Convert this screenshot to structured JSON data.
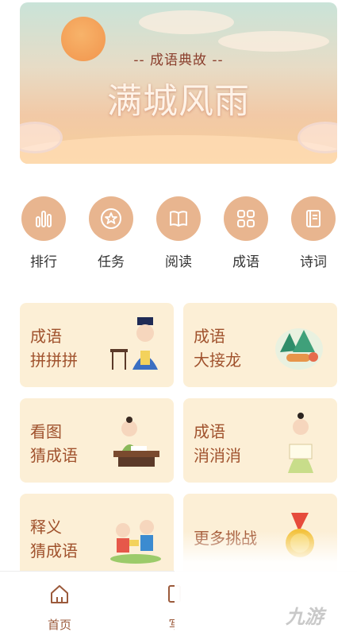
{
  "banner": {
    "subtitle": "-- 成语典故 --",
    "title": "满城风雨"
  },
  "quick_menu": [
    {
      "label": "排行",
      "icon": "bar-chart-icon"
    },
    {
      "label": "任务",
      "icon": "star-medal-icon"
    },
    {
      "label": "阅读",
      "icon": "book-icon"
    },
    {
      "label": "成语",
      "icon": "grid-icon"
    },
    {
      "label": "诗词",
      "icon": "notebook-icon"
    }
  ],
  "games": [
    {
      "line1": "成语",
      "line2": "拼拼拼"
    },
    {
      "line1": "成语",
      "line2": "大接龙"
    },
    {
      "line1": "看图",
      "line2": "猜成语"
    },
    {
      "line1": "成语",
      "line2": "消消消"
    },
    {
      "line1": "释义",
      "line2": "猜成语"
    },
    {
      "line1": "更多挑战",
      "line2": ""
    }
  ],
  "bottom_nav": [
    {
      "label": "首页",
      "icon": "home-icon"
    },
    {
      "label": "写",
      "icon": "write-icon"
    }
  ],
  "watermark": "九游",
  "colors": {
    "accent": "#e8b58f",
    "card_bg": "#fcefd6",
    "card_text": "#a0522d",
    "nav_text": "#9b5a3b"
  }
}
